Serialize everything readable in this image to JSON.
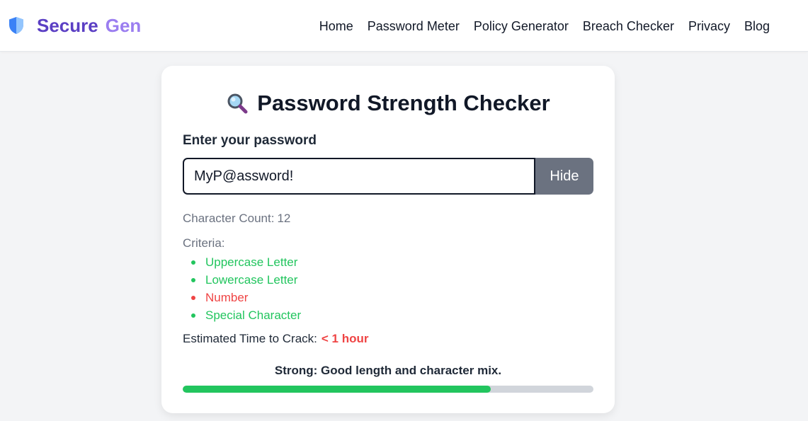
{
  "brand": {
    "part1": "Secure",
    "part2": "Gen",
    "icon": "shield-icon"
  },
  "nav": [
    "Home",
    "Password Meter",
    "Policy Generator",
    "Breach Checker",
    "Privacy",
    "Blog"
  ],
  "checker": {
    "title": "Password Strength Checker",
    "title_icon": "magnifier-icon",
    "input_label": "Enter your password",
    "password_value": "MyP@assword!",
    "hide_label": "Hide",
    "count_label": "Character Count:",
    "count_value": "12",
    "criteria_label": "Criteria:",
    "criteria": [
      {
        "label": "Uppercase Letter",
        "met": true
      },
      {
        "label": "Lowercase Letter",
        "met": true
      },
      {
        "label": "Number",
        "met": false
      },
      {
        "label": "Special Character",
        "met": true
      }
    ],
    "crack_label": "Estimated Time to Crack:",
    "crack_value": "< 1 hour",
    "verdict": "Strong: Good length and character mix.",
    "strength_fraction": 0.75
  },
  "colors": {
    "met": "#22c55e",
    "unmet": "#ef4444",
    "brand_primary": "#5b3fc4",
    "brand_secondary": "#9b7ef0",
    "button": "#6b7280"
  }
}
